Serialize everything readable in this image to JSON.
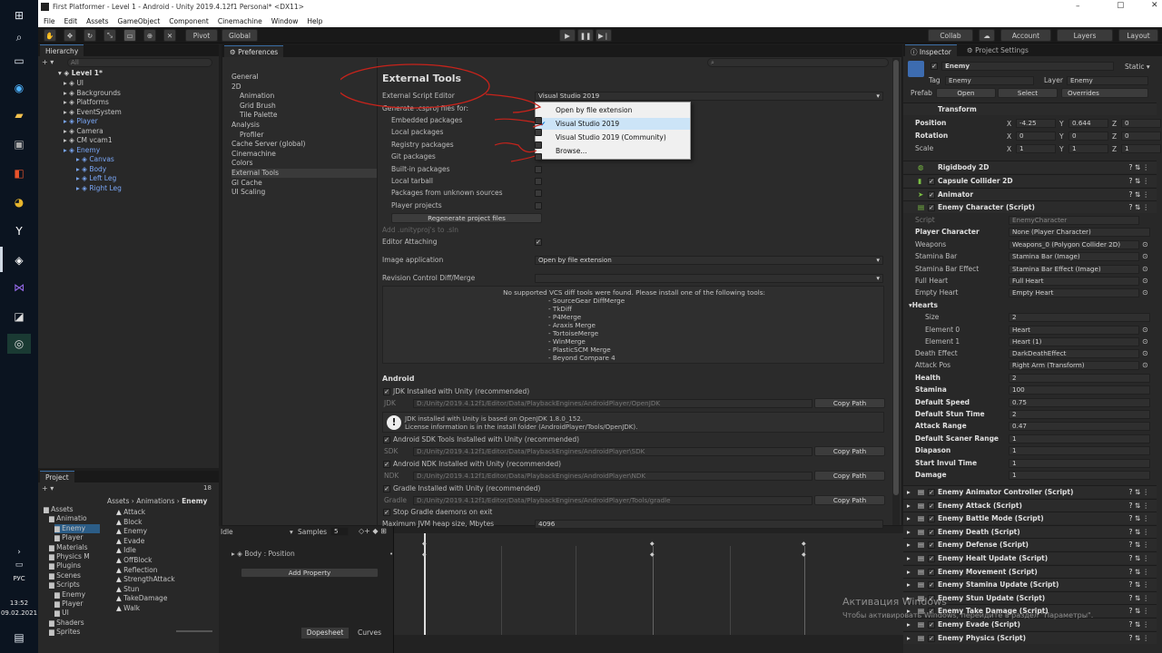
{
  "taskbar": {
    "lang": "РУС",
    "time": "13:52",
    "date": "09.02.2021"
  },
  "titlebar": {
    "title": "First Platformer - Level 1 - Android - Unity 2019.4.12f1 Personal* <DX11>"
  },
  "menu": [
    "File",
    "Edit",
    "Assets",
    "GameObject",
    "Component",
    "Cinemachine",
    "Window",
    "Help"
  ],
  "toolbar": {
    "pivot": "Pivot",
    "global": "Global",
    "collab": "Collab",
    "account": "Account",
    "layers": "Layers",
    "layout": "Layout"
  },
  "hierarchy": {
    "tab": "Hierarchy",
    "search": "All",
    "scene": "Level 1*",
    "items": [
      {
        "label": "UI",
        "indent": 2,
        "blue": false
      },
      {
        "label": "Backgrounds",
        "indent": 2,
        "blue": false
      },
      {
        "label": "Platforms",
        "indent": 2,
        "blue": false
      },
      {
        "label": "EventSystem",
        "indent": 2,
        "blue": false
      },
      {
        "label": "Player",
        "indent": 2,
        "blue": true
      },
      {
        "label": "Camera",
        "indent": 2,
        "blue": false
      },
      {
        "label": "CM vcam1",
        "indent": 2,
        "blue": false
      },
      {
        "label": "Enemy",
        "indent": 2,
        "blue": true
      },
      {
        "label": "Canvas",
        "indent": 3,
        "blue": true
      },
      {
        "label": "Body",
        "indent": 3,
        "blue": true
      },
      {
        "label": "Left Leg",
        "indent": 3,
        "blue": true
      },
      {
        "label": "Right Leg",
        "indent": 3,
        "blue": true
      }
    ]
  },
  "project": {
    "tab": "Project",
    "count": "18",
    "breadcrumb": [
      "Assets",
      "Animations",
      "Enemy"
    ],
    "tree": [
      "Assets",
      "Animatio",
      "Enemy",
      "Player",
      "Materials",
      "Physics M",
      "Plugins",
      "Scenes",
      "Scripts",
      "Enemy",
      "Player",
      "UI",
      "Shaders",
      "Sprites"
    ],
    "files": [
      "Attack",
      "Block",
      "Enemy",
      "Evade",
      "Idle",
      "OffBlock",
      "Reflection",
      "StrengthAttack",
      "Stun",
      "TakeDamage",
      "Walk"
    ]
  },
  "animation": {
    "clip": "Idle",
    "samples_label": "Samples",
    "samples": "5",
    "property": "Body : Position",
    "add_property": "Add Property",
    "dopesheet": "Dopesheet",
    "curves": "Curves"
  },
  "preferences": {
    "tab": "Preferences",
    "nav": [
      "General",
      "2D",
      "Animation",
      "Grid Brush",
      "Tile Palette",
      "Analysis",
      "Profiler",
      "Cache Server (global)",
      "Cinemachine",
      "Colors",
      "External Tools",
      "GI Cache",
      "UI Scaling"
    ],
    "heading": "External Tools",
    "script_editor_label": "External Script Editor",
    "script_editor_value": "Visual Studio 2019",
    "generate_label": "Generate .csproj files for:",
    "packages": [
      "Embedded packages",
      "Local packages",
      "Registry packages",
      "Git packages",
      "Built-in packages",
      "Local tarball",
      "Packages from unknown sources",
      "Player projects"
    ],
    "regenerate": "Regenerate project files",
    "add_unityproj": "Add .unityproj's to .sln",
    "editor_attaching": "Editor Attaching",
    "image_app_label": "Image application",
    "image_app_value": "Open by file extension",
    "revision_label": "Revision Control Diff/Merge",
    "vcs_message": "No supported VCS diff tools were found. Please install one of the following tools:",
    "vcs_tools": [
      "- SourceGear DiffMerge",
      "- TkDiff",
      "- P4Merge",
      "- Araxis Merge",
      "- TortoiseMerge",
      "- WinMerge",
      "- PlasticSCM Merge",
      "- Beyond Compare 4"
    ],
    "android_heading": "Android",
    "jdk_check": "JDK Installed with Unity (recommended)",
    "jdk_label": "JDK",
    "jdk_path": "D:/Unity/2019.4.12f1/Editor/Data/PlaybackEngines/AndroidPlayer/OpenJDK",
    "copy_path": "Copy Path",
    "jdk_info1": "JDK installed with Unity is based on OpenJDK 1.8.0_152.",
    "jdk_info2": "License information is in the install folder (AndroidPlayer/Tools/OpenJDK).",
    "sdk_check": "Android SDK Tools Installed with Unity (recommended)",
    "sdk_label": "SDK",
    "sdk_path": "D:/Unity/2019.4.12f1/Editor/Data/PlaybackEngines/AndroidPlayer\\SDK",
    "ndk_check": "Android NDK Installed with Unity (recommended)",
    "ndk_label": "NDK",
    "ndk_path": "D:/Unity/2019.4.12f1/Editor/Data/PlaybackEngines/AndroidPlayer\\NDK",
    "gradle_check": "Gradle Installed with Unity (recommended)",
    "gradle_label": "Gradle",
    "gradle_path": "D:/Unity/2019.4.12f1/Editor/Data/PlaybackEngines/AndroidPlayer/Tools/gradle",
    "stop_gradle": "Stop Gradle daemons on exit",
    "heap_label": "Maximum JVM heap size, Mbytes",
    "heap_value": "4096",
    "dropdown": [
      "Open by file extension",
      "Visual Studio 2019",
      "Visual Studio 2019 (Community)",
      "Browse..."
    ]
  },
  "inspector": {
    "tab": "Inspector",
    "tab2": "Project Settings",
    "object_name": "Enemy",
    "static_label": "Static",
    "tag_label": "Tag",
    "tag_value": "Enemy",
    "layer_label": "Layer",
    "layer_value": "Enemy",
    "prefab_label": "Prefab",
    "open": "Open",
    "select": "Select",
    "overrides": "Overrides",
    "transform": "Transform",
    "position_label": "Position",
    "rotation_label": "Rotation",
    "scale_label": "Scale",
    "pos": [
      "-4.25",
      "0.644",
      "0"
    ],
    "rot": [
      "0",
      "0",
      "0"
    ],
    "scl": [
      "1",
      "1",
      "1"
    ],
    "components": [
      "Rigidbody 2D",
      "Capsule Collider 2D",
      "Animator",
      "Enemy Character (Script)"
    ],
    "fields": [
      {
        "label": "Script",
        "value": "EnemyCharacter",
        "bold": false,
        "dim": true
      },
      {
        "label": "Player Character",
        "value": "None (Player Character)",
        "bold": true
      },
      {
        "label": "Weapons",
        "value": "Weapons_0 (Polygon Collider 2D)",
        "bold": false
      },
      {
        "label": "Stamina Bar",
        "value": "Stamina Bar (Image)",
        "bold": false
      },
      {
        "label": "Stamina Bar Effect",
        "value": "Stamina Bar Effect (Image)",
        "bold": false
      },
      {
        "label": "Full Heart",
        "value": "Full Heart",
        "bold": false
      },
      {
        "label": "Empty Heart",
        "value": "Empty Heart",
        "bold": false
      }
    ],
    "hearts_label": "Hearts",
    "size_label": "Size",
    "size_value": "2",
    "el0_label": "Element 0",
    "el0_value": "Heart",
    "el1_label": "Element 1",
    "el1_value": "Heart (1)",
    "fields2": [
      {
        "label": "Death Effect",
        "value": "DarkDeathEffect",
        "bold": false
      },
      {
        "label": "Attack Pos",
        "value": "Right Arm (Transform)",
        "bold": false
      },
      {
        "label": "Health",
        "value": "2",
        "bold": true
      },
      {
        "label": "Stamina",
        "value": "100",
        "bold": true
      },
      {
        "label": "Default Speed",
        "value": "0.75",
        "bold": true
      },
      {
        "label": "Default Stun Time",
        "value": "2",
        "bold": true
      },
      {
        "label": "Attack Range",
        "value": "0.47",
        "bold": true
      },
      {
        "label": "Default Scaner Range",
        "value": "1",
        "bold": true
      },
      {
        "label": "Diapason",
        "value": "1",
        "bold": true
      },
      {
        "label": "Start Invul Time",
        "value": "1",
        "bold": true
      },
      {
        "label": "Damage",
        "value": "1",
        "bold": true
      }
    ],
    "scripts": [
      "Enemy Animator Controller (Script)",
      "Enemy Attack (Script)",
      "Enemy Battle Mode (Script)",
      "Enemy Death (Script)",
      "Enemy Defense (Script)",
      "Enemy Healt Update (Script)",
      "Enemy Movement (Script)",
      "Enemy Stamina Update (Script)",
      "Enemy Stun Update (Script)",
      "Enemy Take Damage (Script)",
      "Enemy Evade (Script)",
      "Enemy Physics (Script)"
    ]
  },
  "watermark": {
    "line1": "Активация Windows",
    "line2": "Чтобы активировать Windows, перейдите в раздел \"Параметры\"."
  }
}
